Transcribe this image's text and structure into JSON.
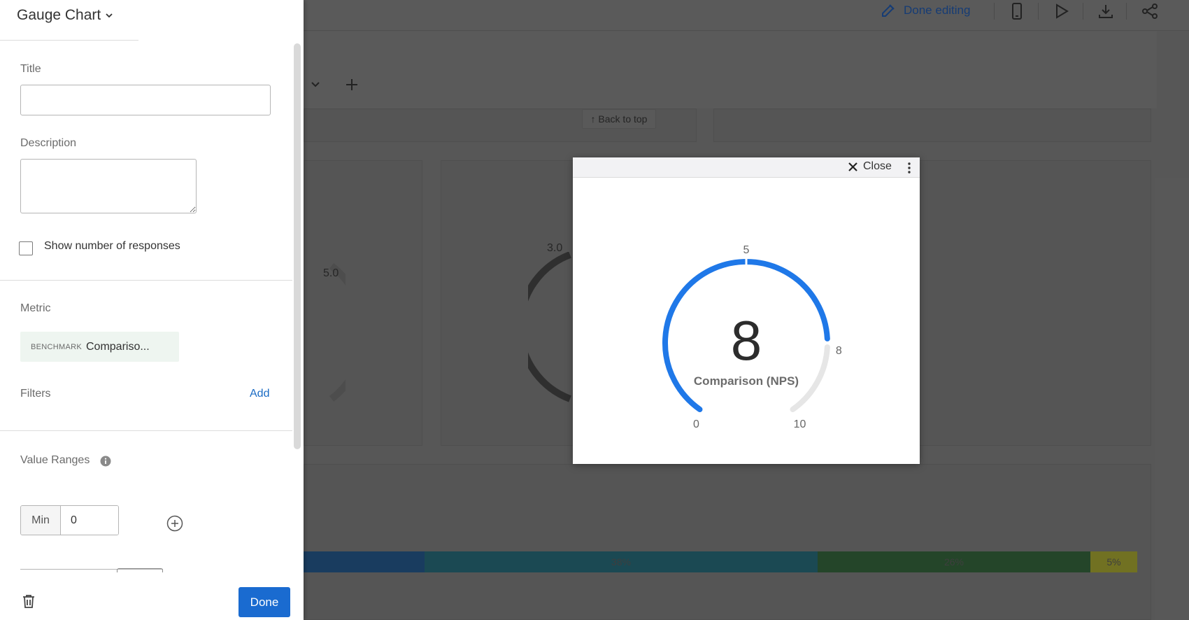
{
  "dashboard": {
    "done_editing": "Done editing",
    "back_to_top": "↑ Back to top",
    "tick_a": "5.0",
    "tick_b": "3.0",
    "bar_segments": [
      {
        "label": "",
        "color": "#1f4a75"
      },
      {
        "label": "38%",
        "color": "#225a66"
      },
      {
        "label": "26%",
        "color": "#2d5533"
      },
      {
        "label": "5%",
        "color": "#8a8a2a"
      }
    ]
  },
  "editor": {
    "title": "Gauge Chart",
    "title_field_label": "Title",
    "title_value": "",
    "description_label": "Description",
    "description_value": "",
    "show_responses_label": "Show number of responses",
    "show_responses_checked": false,
    "metric_label": "Metric",
    "metric_tag": "BENCHMARK",
    "metric_name": "Compariso...",
    "filters_label": "Filters",
    "filters_add": "Add",
    "value_ranges_label": "Value Ranges",
    "min_label": "Min",
    "min_value": "0",
    "done_label": "Done"
  },
  "modal": {
    "close_label": "Close"
  },
  "chart_data": {
    "type": "gauge",
    "value": 8,
    "value_label": "8",
    "caption": "Comparison (NPS)",
    "min": 0,
    "max": 10,
    "tick_min": "0",
    "tick_max": "10",
    "tick_top": "5",
    "tick_value": "8",
    "fill_color": "#1f78e8",
    "track_color": "#e6e6e6"
  }
}
